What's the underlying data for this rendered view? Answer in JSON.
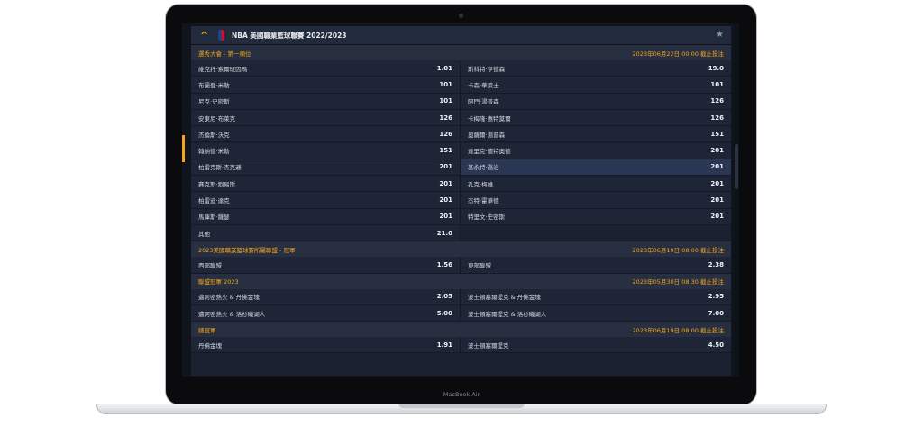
{
  "device": {
    "brand_label": "MacBook Air"
  },
  "panel": {
    "title": "NBA 美國職業籃球聯賽 2022/2023",
    "collapse_icon": "chevron-up-icon",
    "favorite_icon": "star-icon"
  },
  "sections": [
    {
      "name": "選秀大會 - 第一順位",
      "deadline": "2023年06月22日 00:00 截止投注",
      "rows": [
        {
          "left": {
            "name": "維克托·索爾班因瑪",
            "odds": "1.01"
          },
          "right": {
            "name": "斯科特·亨德森",
            "odds": "19.0"
          }
        },
        {
          "left": {
            "name": "布蘭登·米勒",
            "odds": "101"
          },
          "right": {
            "name": "卡森·華萊士",
            "odds": "101"
          }
        },
        {
          "left": {
            "name": "尼克·史密斯",
            "odds": "101"
          },
          "right": {
            "name": "阿門·湯普森",
            "odds": "126"
          }
        },
        {
          "left": {
            "name": "安東尼·布萊克",
            "odds": "126"
          },
          "right": {
            "name": "卡梅隆·惠特莫爾",
            "odds": "126"
          }
        },
        {
          "left": {
            "name": "杰倫斯·沃克",
            "odds": "126"
          },
          "right": {
            "name": "奧薩爾·湯普森",
            "odds": "151"
          }
        },
        {
          "left": {
            "name": "翰納德·米勒",
            "odds": "151"
          },
          "right": {
            "name": "達里克·懷特奧德",
            "odds": "201"
          }
        },
        {
          "left": {
            "name": "柏雷克斯·杰克遜",
            "odds": "201",
            "highlighted": false
          },
          "right": {
            "name": "基永特·喬治",
            "odds": "201",
            "highlighted": true
          }
        },
        {
          "left": {
            "name": "賽克斯·劉易斯",
            "odds": "201"
          },
          "right": {
            "name": "孔克·梅維",
            "odds": "201"
          }
        },
        {
          "left": {
            "name": "柏雷迪·達克",
            "odds": "201"
          },
          "right": {
            "name": "杰特·霍華德",
            "odds": "201"
          }
        },
        {
          "left": {
            "name": "馬庫斯·薩瑟",
            "odds": "201"
          },
          "right": {
            "name": "特里文·史密斯",
            "odds": "201"
          }
        },
        {
          "left": {
            "name": "其他",
            "odds": "21.0"
          },
          "right": null
        }
      ]
    },
    {
      "name": "2023美國職業籃球賽所屬聯盟 - 冠軍",
      "deadline": "2023年06月19日 08:00 截止投注",
      "rows": [
        {
          "left": {
            "name": "西部聯盟",
            "odds": "1.56"
          },
          "right": {
            "name": "東部聯盟",
            "odds": "2.38"
          }
        }
      ]
    },
    {
      "name": "聯盟冠軍 2023",
      "deadline": "2023年05月30日 08:30 截止投注",
      "rows": [
        {
          "left": {
            "name": "邁阿密熱火 & 丹佛金塊",
            "odds": "2.05"
          },
          "right": {
            "name": "波士頓塞爾提克 & 丹佛金塊",
            "odds": "2.95"
          }
        },
        {
          "left": {
            "name": "邁阿密熱火 & 洛杉磯湖人",
            "odds": "5.00"
          },
          "right": {
            "name": "波士頓塞爾提克 & 洛杉磯湖人",
            "odds": "7.00"
          }
        }
      ]
    },
    {
      "name": "總冠軍",
      "deadline": "2023年06月19日 08:00 截止投注",
      "rows": [
        {
          "left": {
            "name": "丹佛金塊",
            "odds": "1.91"
          },
          "right": {
            "name": "波士頓塞爾提克",
            "odds": "4.50"
          }
        }
      ]
    }
  ]
}
